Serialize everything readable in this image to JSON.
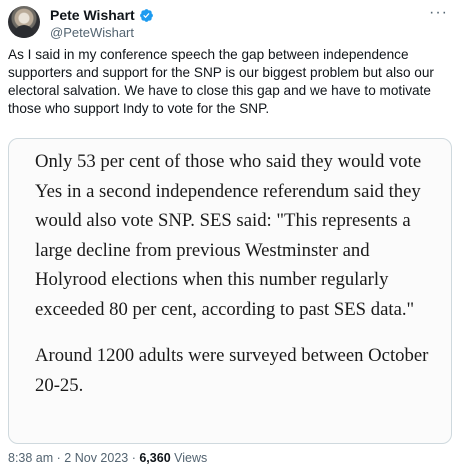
{
  "author": {
    "name": "Pete Wishart",
    "handle": "@PeteWishart",
    "verified": true
  },
  "tweet": {
    "text": "As I said in my conference speech the gap between independence supporters and support for the SNP is our biggest problem but also our electoral salvation. We have to close this gap and we have to motivate those who support Indy to vote for the SNP."
  },
  "quote": {
    "paragraphs": [
      "Only 53 per cent of those who said they would vote Yes in a second independence referendum said they would also vote SNP. SES said: \"This represents a large decline from previous Westminster and Holyrood elections when this number regularly exceeded 80 per cent, according to past SES data.\"",
      "Around 1200 adults were surveyed between October 20-25."
    ]
  },
  "meta": {
    "time": "8:38 am",
    "date": "2 Nov 2023",
    "views_count": "6,360",
    "views_label": "Views"
  },
  "icons": {
    "verified": "verified-badge-icon",
    "more": "more-options-icon"
  },
  "colors": {
    "verified_badge": "#1d9bf0",
    "secondary_text": "#536471"
  }
}
